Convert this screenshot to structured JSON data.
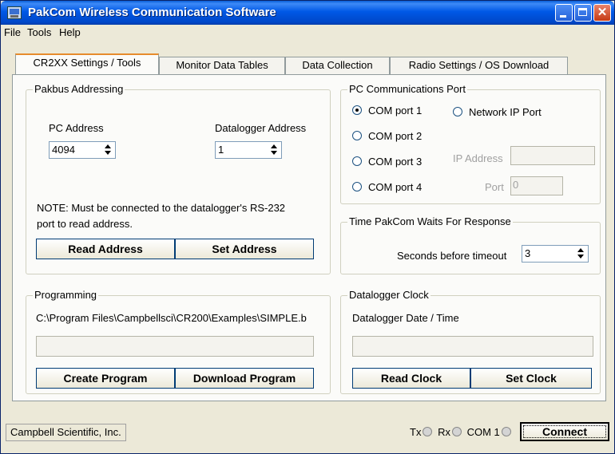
{
  "window": {
    "title": "PakCom Wireless Communication Software"
  },
  "menu": {
    "items": [
      "File",
      "Tools",
      "Help"
    ]
  },
  "tabs": [
    {
      "label": "CR2XX Settings / Tools"
    },
    {
      "label": "Monitor Data Tables"
    },
    {
      "label": "Data Collection"
    },
    {
      "label": "Radio Settings / OS Download"
    }
  ],
  "pakbus": {
    "legend": "Pakbus Addressing",
    "pc_address_label": "PC Address",
    "pc_address_value": "4094",
    "datalogger_address_label": "Datalogger Address",
    "datalogger_address_value": "1",
    "note_line1": "NOTE: Must be connected to the datalogger's RS-232",
    "note_line2": "port to read address.",
    "read_button": "Read Address",
    "set_button": "Set Address"
  },
  "comport": {
    "legend": "PC Communications Port",
    "options": [
      "COM port 1",
      "COM port 2",
      "COM port 3",
      "COM port 4"
    ],
    "selected": "COM port 1",
    "network_label": "Network IP Port",
    "ip_label": "IP Address",
    "port_label": "Port",
    "port_value": "0"
  },
  "timeout": {
    "legend": "Time PakCom Waits For Response",
    "label": "Seconds before timeout",
    "value": "3"
  },
  "programming": {
    "legend": "Programming",
    "path": "C:\\Program Files\\Campbellsci\\CR200\\Examples\\SIMPLE.b",
    "create_button": "Create Program",
    "download_button": "Download Program"
  },
  "clock": {
    "legend": "Datalogger Clock",
    "label": "Datalogger Date / Time",
    "read_button": "Read Clock",
    "set_button": "Set Clock"
  },
  "status": {
    "company": "Campbell Scientific, Inc.",
    "tx": "Tx",
    "rx": "Rx",
    "com": "COM 1",
    "connect_button": "Connect"
  }
}
